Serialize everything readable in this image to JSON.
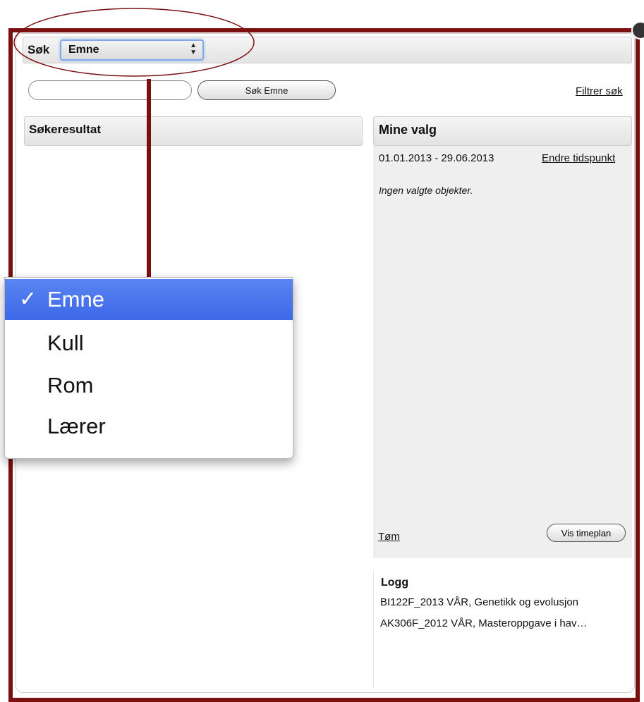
{
  "search": {
    "label": "Søk",
    "select_value": "Emne",
    "input_value": "",
    "button_label": "Søk Emne",
    "filter_link": "Filtrer søk"
  },
  "results": {
    "header": "Søkeresultat"
  },
  "mine": {
    "header": "Mine valg",
    "date_range": "01.01.2013 - 29.06.2013",
    "change_time_link": "Endre tidspunkt",
    "empty_text": "Ingen valgte objekter.",
    "clear_link": "Tøm",
    "show_schedule_button": "Vis timeplan"
  },
  "log": {
    "title": "Logg",
    "entries": [
      "BI122F_2013 VÅR, Genetikk og evolusjon",
      "AK306F_2012 VÅR, Masteroppgave i hav…"
    ]
  },
  "dropdown": {
    "check_mark": "✓",
    "options": [
      "Emne",
      "Kull",
      "Rom",
      "Lærer"
    ],
    "selected_index": 0
  },
  "colors": {
    "frame": "#7a1010",
    "selection": "#3d68e8",
    "focus": "#7fa9ea"
  }
}
